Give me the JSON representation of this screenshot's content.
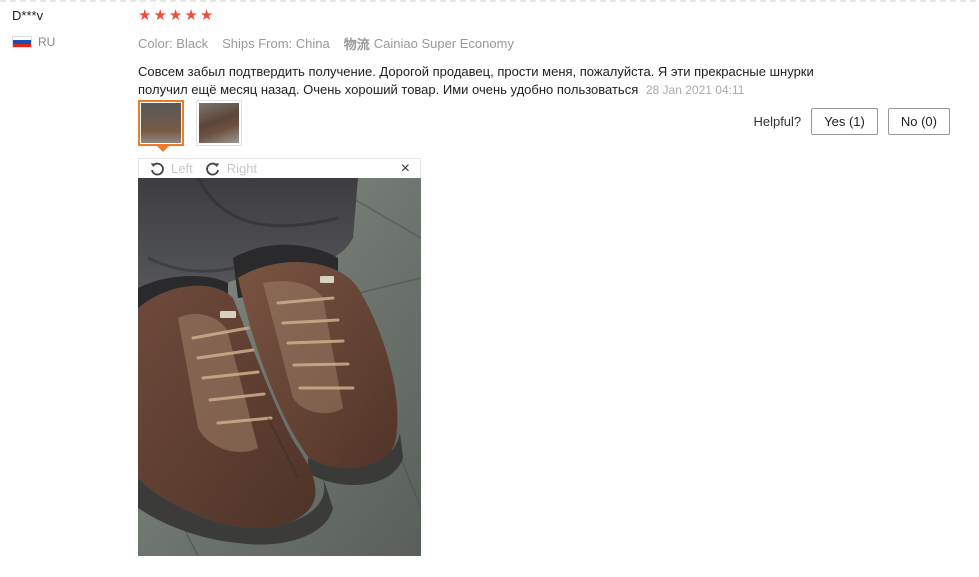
{
  "user": {
    "name": "D***v",
    "country": "RU"
  },
  "review": {
    "rating": 5,
    "stars": [
      "★",
      "★",
      "★",
      "★",
      "★"
    ],
    "color": "Color: Black",
    "ships_from": "Ships From: China",
    "logistics_tag": "物流",
    "logistics": "Cainiao Super Economy",
    "text": "Совсем забыл подтвердить получение. Дорогой продавец, прости меня, пожалуйста. Я эти прекрасные шнурки получил ещё месяц назад. Очень хороший товар. Ими очень удобно пользоваться",
    "date": "28 Jan 2021 04:11"
  },
  "helpful": {
    "label": "Helpful?",
    "yes": "Yes (1)",
    "no": "No (0)"
  },
  "viewer": {
    "rotate_left": "Left",
    "rotate_right": "Right",
    "close": "×"
  },
  "colors": {
    "star": "#f44b3c",
    "active_thumb": "#f07c2a"
  }
}
